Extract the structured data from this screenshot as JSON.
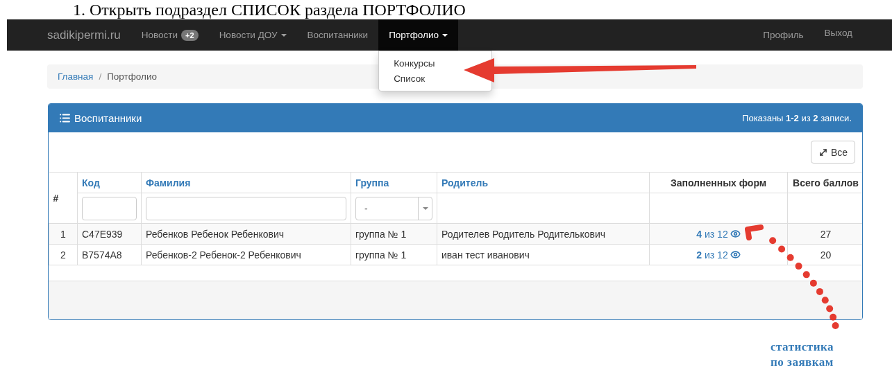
{
  "instruction": "1.  Открыть подраздел СПИСОК раздела ПОРТФОЛИО",
  "navbar": {
    "brand": "sadikipermi.ru",
    "items": [
      {
        "label": "Новости",
        "badge": "+2",
        "caret": false,
        "selected": false
      },
      {
        "label": "Новости ДОУ",
        "caret": true,
        "selected": false
      },
      {
        "label": "Воспитанники",
        "caret": false,
        "selected": false
      },
      {
        "label": "Портфолио",
        "caret": true,
        "selected": true,
        "menu": [
          "Конкурсы",
          "Список"
        ]
      }
    ],
    "right_items": [
      "Профиль",
      "Выход"
    ]
  },
  "breadcrumb": {
    "separator": "/",
    "items": [
      {
        "label": "Главная",
        "kind": "link"
      },
      {
        "label": "Портфолио",
        "kind": "current"
      }
    ]
  },
  "panel": {
    "title": "Воспитанники",
    "summary": "Показаны **1-2** из **2** записи.",
    "expand_button": "Все",
    "columns": [
      {
        "label": "#",
        "sortable": false,
        "filter": {
          "kind": "none"
        }
      },
      {
        "label": "Код",
        "sortable": true,
        "filter": {
          "kind": "text"
        }
      },
      {
        "label": "Фамилия",
        "sortable": true,
        "filter": {
          "kind": "text"
        }
      },
      {
        "label": "Группа",
        "sortable": true,
        "filter": {
          "kind": "select",
          "value": "-"
        }
      },
      {
        "label": "Родитель",
        "sortable": true,
        "filter": {
          "kind": "blank"
        }
      },
      {
        "label": "Заполненных форм",
        "sortable": false,
        "filter": {
          "kind": "blank"
        }
      },
      {
        "label": "Всего баллов",
        "sortable": false,
        "filter": {
          "kind": "blank"
        }
      }
    ],
    "rows": [
      {
        "number": "1",
        "code": "C47E939",
        "name": "Ребенков Ребенок Ребенкович",
        "group": "группа № 1",
        "parent": "Родителев Родитель Родителькович",
        "forms": "**4** из 12",
        "score": "27"
      },
      {
        "number": "2",
        "code": "B7574A8",
        "name": "Ребенков-2 Ребенок-2 Ребенкович",
        "group": "группа № 1",
        "parent": "иван тест иванович",
        "forms": "**2** из 12",
        "score": "20"
      }
    ]
  },
  "annotation": {
    "lines": [
      "статистика",
      "по заявкам"
    ]
  }
}
